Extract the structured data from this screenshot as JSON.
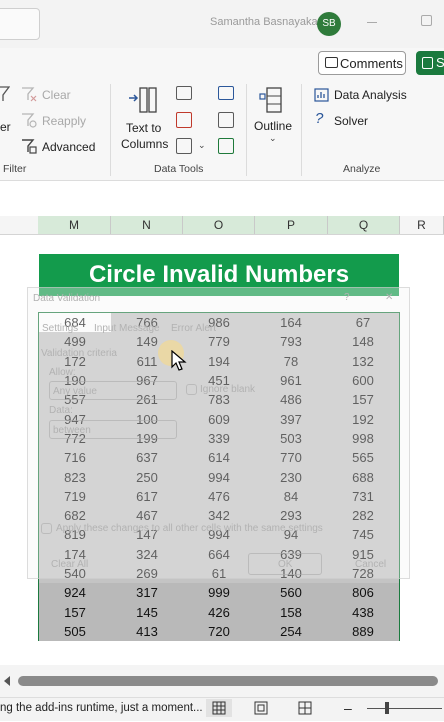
{
  "titlebar": {
    "user_name": "Samantha Basnayaka",
    "avatar_initials": "SB"
  },
  "ribbon": {
    "comments_label": "Comments",
    "share_label": "S",
    "filter_group": {
      "clear_label": "Clear",
      "reapply_label": "Reapply",
      "advanced_label": "Advanced",
      "partial_label": "er",
      "group_label": "Filter"
    },
    "data_tools_group": {
      "text_to_columns_line1": "Text to",
      "text_to_columns_line2": "Columns",
      "group_label": "Data Tools"
    },
    "outline_label": "Outline",
    "analyze_group": {
      "data_analysis_label": "Data Analysis",
      "solver_label": "Solver",
      "group_label": "Analyze"
    }
  },
  "sheet": {
    "columns": [
      "M",
      "N",
      "O",
      "P",
      "Q"
    ],
    "extra_column": "R",
    "banner_title": "Circle Invalid Numbers",
    "rows": [
      [
        684,
        766,
        986,
        164,
        67
      ],
      [
        499,
        149,
        779,
        793,
        148
      ],
      [
        172,
        611,
        194,
        78,
        132
      ],
      [
        190,
        967,
        451,
        961,
        600
      ],
      [
        557,
        261,
        783,
        486,
        157
      ],
      [
        947,
        100,
        609,
        397,
        192
      ],
      [
        772,
        199,
        339,
        503,
        998
      ],
      [
        716,
        637,
        614,
        770,
        565
      ],
      [
        823,
        250,
        994,
        230,
        688
      ],
      [
        719,
        617,
        476,
        84,
        731
      ],
      [
        682,
        467,
        342,
        293,
        282
      ],
      [
        819,
        147,
        994,
        94,
        745
      ],
      [
        174,
        324,
        664,
        639,
        915
      ],
      [
        540,
        269,
        61,
        140,
        728
      ],
      [
        924,
        317,
        999,
        560,
        806
      ],
      [
        157,
        145,
        426,
        158,
        438
      ],
      [
        505,
        413,
        720,
        254,
        889
      ]
    ]
  },
  "dialog": {
    "title": "Data Validation",
    "help": "?",
    "close": "✕",
    "tab_settings": "Settings",
    "tab_input": "Input Message",
    "tab_error": "Error Alert",
    "criteria_label": "Validation criteria",
    "allow_label": "Allow:",
    "allow_value": "Any value",
    "ignore_blank": "Ignore blank",
    "data_label": "Data:",
    "data_value": "between",
    "apply_all": "Apply these changes to all other cells with the same settings",
    "clear_all": "Clear All",
    "ok": "OK",
    "cancel": "Cancel"
  },
  "statusbar": {
    "message": "ng the add-ins runtime, just a moment..."
  }
}
